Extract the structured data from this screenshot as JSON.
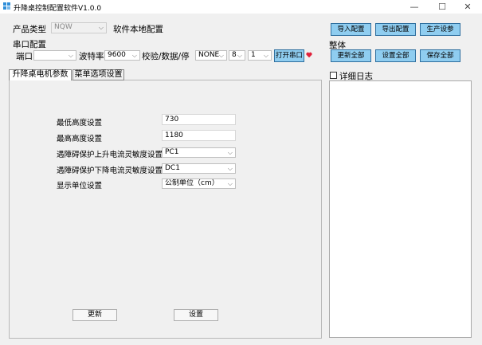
{
  "window": {
    "title": "升降桌控制配置软件V1.0.0",
    "minimize": "—",
    "maximize": "☐",
    "close": "✕"
  },
  "product": {
    "label": "产品类型",
    "value": "NQW",
    "local_config": "软件本地配置"
  },
  "top_buttons": {
    "import": "导入配置",
    "export": "导出配置",
    "production": "生产设参"
  },
  "serial": {
    "group_label": "串口配置",
    "port_label": "端口",
    "baud_label": "波特率",
    "baud_value": "9600",
    "check_label": "校验/数据/停",
    "parity_value": "NONE",
    "databits_value": "8",
    "stopbits_value": "1",
    "open_button": "打开串口"
  },
  "overall": {
    "group_label": "整体",
    "update_all": "更新全部",
    "set_all": "设置全部",
    "save_all": "保存全部"
  },
  "tabs": {
    "motor_params": "升降桌电机参数",
    "menu_options": "菜单选项设置"
  },
  "settings": {
    "min_height": {
      "label": "最低高度设置",
      "value": "730"
    },
    "max_height": {
      "label": "最高高度设置",
      "value": "1180"
    },
    "up_protect": {
      "label": "遇障碍保护上升电流灵敏度设置",
      "value": "PC1"
    },
    "down_protect": {
      "label": "遇障碍保护下降电流灵敏度设置",
      "value": "DC1"
    },
    "unit": {
      "label": "显示单位设置",
      "value": "公制单位（cm）"
    }
  },
  "bottom_buttons": {
    "update": "更新",
    "set": "设置"
  },
  "log": {
    "label": "详细日志"
  },
  "colors": {
    "accent_button": "#8fcdf0",
    "status_heart": "#e0203a"
  }
}
